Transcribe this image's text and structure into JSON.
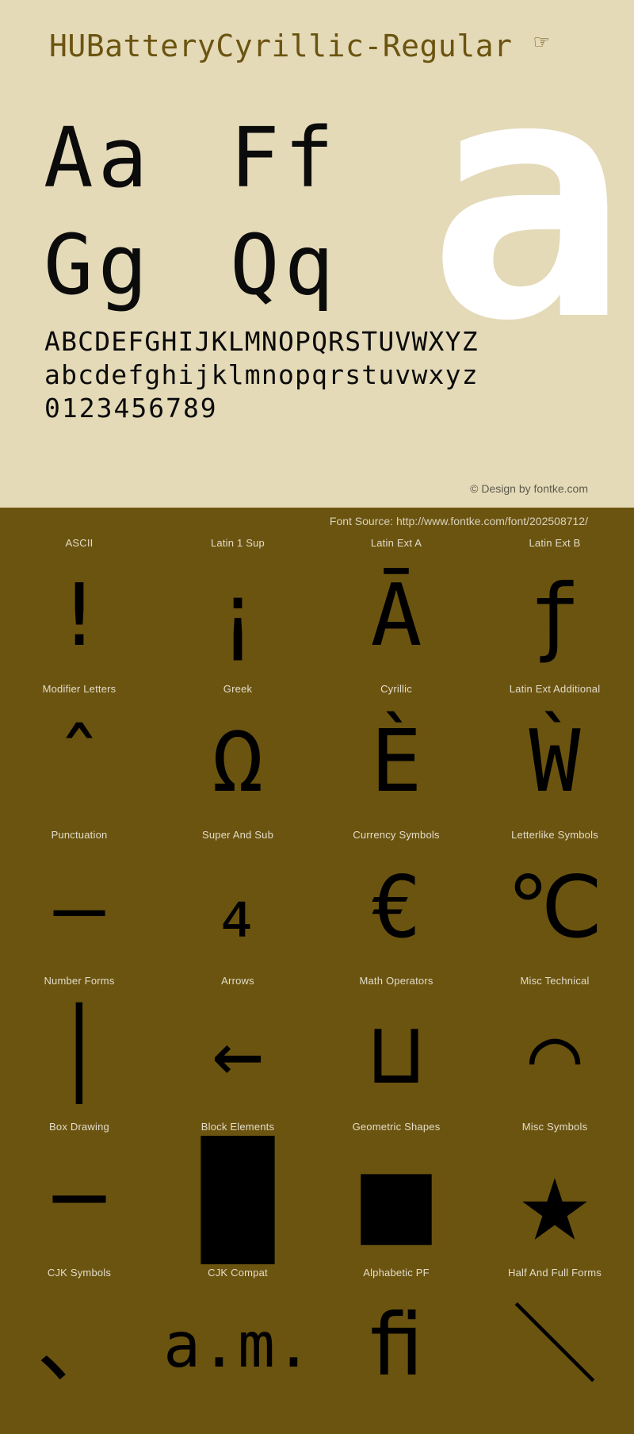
{
  "header": {
    "font_name": "HUBatteryCyrillic-Regular",
    "hand_icon": "☞"
  },
  "specimen": {
    "watermark_glyph": "a",
    "letter_pairs": [
      [
        "Aa",
        "Ff"
      ],
      [
        "Gg",
        "Qq"
      ]
    ],
    "uppercase": "ABCDEFGHIJKLMNOPQRSTUVWXYZ",
    "lowercase": "abcdefghijklmnopqrstuvwxyz",
    "digits": "0123456789",
    "copyright": "© Design by fontke.com"
  },
  "source": {
    "label": "Font Source: http://www.fontke.com/font/202508712/"
  },
  "unicode_blocks": [
    [
      {
        "label": "ASCII",
        "glyph": "!",
        "size": "normal"
      },
      {
        "label": "Latin 1 Sup",
        "glyph": "¡",
        "size": "normal"
      },
      {
        "label": "Latin Ext A",
        "glyph": "Ā",
        "size": "normal"
      },
      {
        "label": "Latin Ext B",
        "glyph": "ƒ",
        "size": "normal"
      }
    ],
    [
      {
        "label": "Modifier Letters",
        "glyph": "ˆ",
        "size": "normal"
      },
      {
        "label": "Greek",
        "glyph": "Ω",
        "size": "normal"
      },
      {
        "label": "Cyrillic",
        "glyph": "Ѐ",
        "size": "normal"
      },
      {
        "label": "Latin Ext Additional",
        "glyph": "Ẁ",
        "size": "normal"
      }
    ],
    [
      {
        "label": "Punctuation",
        "glyph": "—",
        "size": "normal"
      },
      {
        "label": "Super And Sub",
        "glyph": "₄",
        "size": "normal"
      },
      {
        "label": "Currency Symbols",
        "glyph": "€",
        "size": "normal"
      },
      {
        "label": "Letterlike Symbols",
        "glyph": "℃",
        "size": "normal"
      }
    ],
    [
      {
        "label": "Number Forms",
        "glyph": "│",
        "size": "normal"
      },
      {
        "label": "Arrows",
        "glyph": "←",
        "size": "normal"
      },
      {
        "label": "Math Operators",
        "glyph": "⊔",
        "size": "normal"
      },
      {
        "label": "Misc Technical",
        "glyph": "⌒",
        "size": "normal"
      }
    ],
    [
      {
        "label": "Box Drawing",
        "glyph": "─",
        "size": "normal"
      },
      {
        "label": "Block Elements",
        "glyph": "█",
        "size": "shape"
      },
      {
        "label": "Geometric Shapes",
        "glyph": "■",
        "size": "shape"
      },
      {
        "label": "Misc Symbols",
        "glyph": "★",
        "size": "shape"
      }
    ],
    [
      {
        "label": "CJK Symbols",
        "glyph": "、",
        "size": "normal"
      },
      {
        "label": "CJK Compat",
        "glyph": "a.m.",
        "size": "sm"
      },
      {
        "label": "Alphabetic PF",
        "glyph": "ﬁ",
        "size": "normal"
      },
      {
        "label": "Half And Full Forms",
        "glyph": "＼",
        "size": "normal"
      }
    ]
  ],
  "colors": {
    "paper": "#e4dab8",
    "dark_panel": "#6b5410",
    "title": "#6b5410",
    "glyph": "#000000",
    "watermark": "#ffffff"
  }
}
